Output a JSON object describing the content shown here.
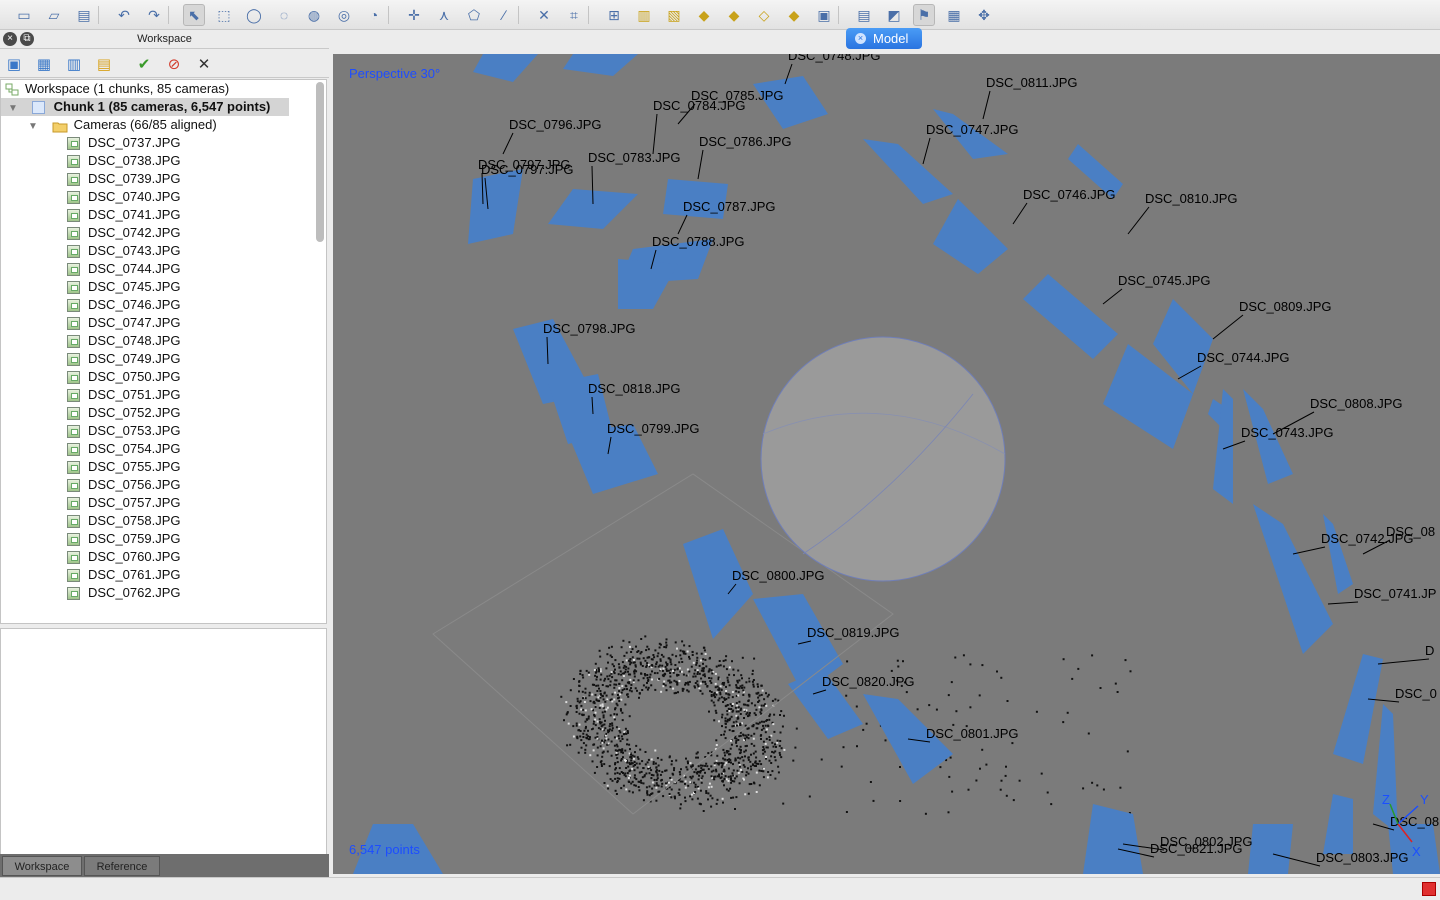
{
  "toolbar": {
    "icons": [
      "new-document",
      "open-folder",
      "save",
      "undo",
      "redo",
      "select-arrow",
      "rectangle-selection",
      "circle-selection",
      "free-form-selection",
      "resize-region",
      "rotate-region",
      "rotate-object",
      "navigation",
      "ruler",
      "draw-polygon",
      "draw-line",
      "delete-selection",
      "crop",
      "show-cameras",
      "show-dense",
      "show-model",
      "show-tiled",
      "show-texture",
      "show-dem",
      "show-ortho",
      "show-markers",
      "show-images",
      "show-aligned",
      "show-shapes",
      "show-region",
      "reset-view"
    ]
  },
  "workspace": {
    "title": "Workspace",
    "root": "Workspace (1 chunks, 85 cameras)",
    "chunk": "Chunk 1 (85 cameras, 6,547 points)",
    "cameras_folder": "Cameras (66/85 aligned)",
    "cameras": [
      "DSC_0737.JPG",
      "DSC_0738.JPG",
      "DSC_0739.JPG",
      "DSC_0740.JPG",
      "DSC_0741.JPG",
      "DSC_0742.JPG",
      "DSC_0743.JPG",
      "DSC_0744.JPG",
      "DSC_0745.JPG",
      "DSC_0746.JPG",
      "DSC_0747.JPG",
      "DSC_0748.JPG",
      "DSC_0749.JPG",
      "DSC_0750.JPG",
      "DSC_0751.JPG",
      "DSC_0752.JPG",
      "DSC_0753.JPG",
      "DSC_0754.JPG",
      "DSC_0755.JPG",
      "DSC_0756.JPG",
      "DSC_0757.JPG",
      "DSC_0758.JPG",
      "DSC_0759.JPG",
      "DSC_0760.JPG",
      "DSC_0761.JPG",
      "DSC_0762.JPG"
    ],
    "toolbar_icons": [
      "add-chunk",
      "add-photos",
      "add-folder",
      "add-marker",
      "enable",
      "disable",
      "remove"
    ]
  },
  "tabs": [
    "Workspace",
    "Reference"
  ],
  "viewport": {
    "tab_label": "Model",
    "projection": "Perspective 30°",
    "point_count": "6,547 points",
    "axes": {
      "x": "X",
      "y": "Y",
      "z": "Z"
    },
    "camera_labels": [
      "DSC_0748.JPG",
      "DSC_0785.JPG",
      "DSC_0784.JPG",
      "DSC_0811.JPG",
      "DSC_0796.JPG",
      "DSC_0747.JPG",
      "DSC_0786.JPG",
      "DSC_0797.JPG",
      "DSC_0797.JPG",
      "DSC_0783.JPG",
      "DSC_0746.JPG",
      "DSC_0810.JPG",
      "DSC_0787.JPG",
      "DSC_0788.JPG",
      "DSC_0745.JPG",
      "DSC_0809.JPG",
      "DSC_0798.JPG",
      "DSC_0744.JPG",
      "DSC_0818.JPG",
      "DSC_0808.JPG",
      "DSC_0799.JPG",
      "DSC_0743.JPG",
      "DSC_0742.JPG",
      "DSC_08",
      "DSC_0800.JPG",
      "DSC_0741.JP",
      "DSC_0819.JPG",
      "D",
      "DSC_0820.JPG",
      "DSC_0",
      "DSC_0801.JPG",
      "DSC_08",
      "DSC_0802.JPG",
      "DSC_0821.JPG",
      "DSC_0803.JPG"
    ]
  },
  "colors": {
    "viewport_bg": "#7b7b7b",
    "camera_blue": "#4a7fc4",
    "overlay_text": "#1d4dff",
    "model_tab": "#2f7fe8"
  }
}
